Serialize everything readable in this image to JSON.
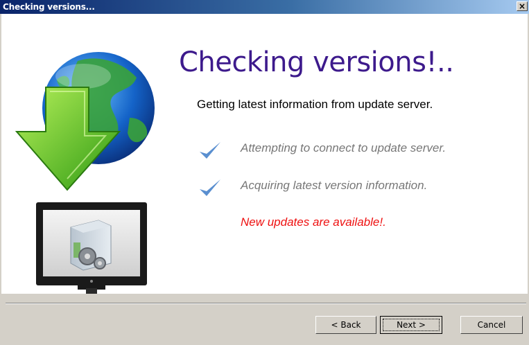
{
  "window": {
    "title": "Checking versions...",
    "close_glyph": "✕"
  },
  "main": {
    "heading": "Checking versions!..",
    "subtitle": "Getting latest information from update server.",
    "steps": [
      {
        "icon": "checkmark-icon",
        "label": "Attempting to connect to update server."
      },
      {
        "icon": "checkmark-icon",
        "label": "Acquiring latest version information."
      }
    ],
    "result": "New updates are available!."
  },
  "buttons": {
    "back": "< Back",
    "next": "Next >",
    "cancel": "Cancel"
  },
  "colors": {
    "heading": "#3d1a8c",
    "result": "#ee1111",
    "step_text": "#777777",
    "check": "#5a8fd0"
  }
}
